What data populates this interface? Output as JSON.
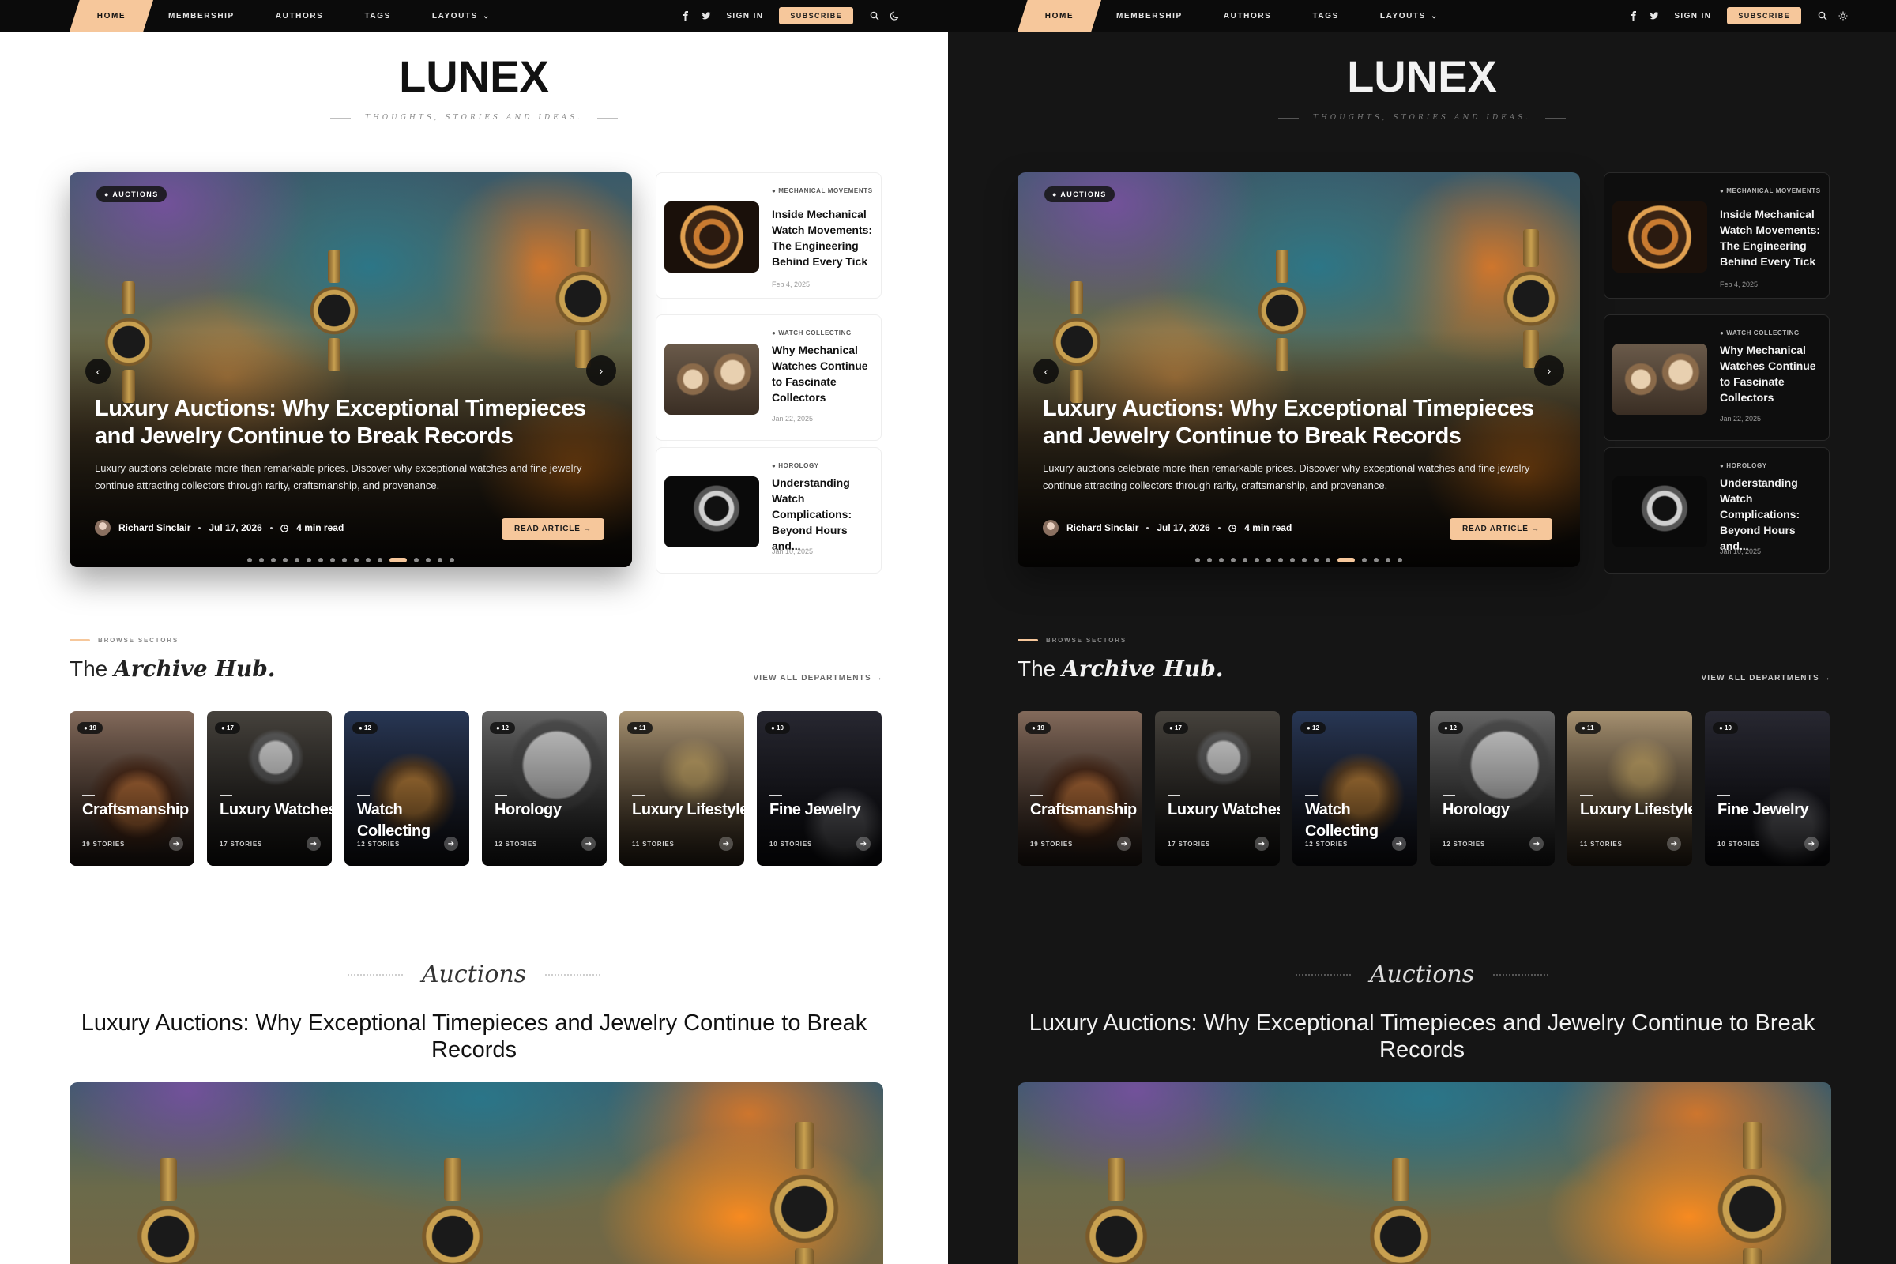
{
  "nav": {
    "home": "HOME",
    "links": [
      "MEMBERSHIP",
      "AUTHORS",
      "TAGS",
      "LAYOUTS"
    ],
    "sign_in": "SIGN IN",
    "subscribe": "SUBSCRIBE",
    "icons": [
      "facebook-icon",
      "twitter-icon",
      "search-icon",
      "theme-toggle-icon"
    ]
  },
  "brand": {
    "logo": "LUNEX",
    "tagline": "THOUGHTS, STORIES AND IDEAS."
  },
  "hero": {
    "badge": "● AUCTIONS",
    "title": "Luxury Auctions: Why Exceptional Timepieces and Jewelry Continue to Break Records",
    "excerpt": "Luxury auctions celebrate more than remarkable prices. Discover why exceptional watches and fine jewelry continue attracting collectors through rarity, craftsmanship, and provenance.",
    "author": "Richard Sinclair",
    "date": "Jul 17, 2026",
    "read_time": "4 min read",
    "button": "READ ARTICLE →",
    "slide_count": 17,
    "active_slide": 12
  },
  "side_posts": [
    {
      "category": "● MECHANICAL MOVEMENTS",
      "title": "Inside Mechanical Watch Movements: The Engineering Behind Every Tick",
      "date": "Feb 4, 2025"
    },
    {
      "category": "● WATCH COLLECTING",
      "title": "Why Mechanical Watches Continue to Fascinate Collectors",
      "date": "Jan 22, 2025"
    },
    {
      "category": "● HOROLOGY",
      "title": "Understanding Watch Complications: Beyond Hours and...",
      "date": "Jan 10, 2025"
    }
  ],
  "archive": {
    "eyebrow": "BROWSE SECTORS",
    "title_plain": "The ",
    "title_em": "Archive Hub.",
    "view_all": "VIEW ALL DEPARTMENTS →",
    "tiles": [
      {
        "count": "● 19",
        "name": "Craftsmanship",
        "stories": "19 STORIES"
      },
      {
        "count": "● 17",
        "name": "Luxury Watches",
        "stories": "17 STORIES"
      },
      {
        "count": "● 12",
        "name": "Watch Collecting",
        "stories": "12 STORIES"
      },
      {
        "count": "● 12",
        "name": "Horology",
        "stories": "12 STORIES"
      },
      {
        "count": "● 11",
        "name": "Luxury Lifestyle",
        "stories": "11 STORIES"
      },
      {
        "count": "● 10",
        "name": "Fine Jewelry",
        "stories": "10 STORIES"
      }
    ]
  },
  "section": {
    "label": "Auctions",
    "title": "Luxury Auctions: Why Exceptional Timepieces and Jewelry Continue to Break Records"
  },
  "colors": {
    "accent": "#f6c79b",
    "nav_bg": "#0b0b0b",
    "light_bg": "#ffffff",
    "dark_bg": "#151515"
  }
}
